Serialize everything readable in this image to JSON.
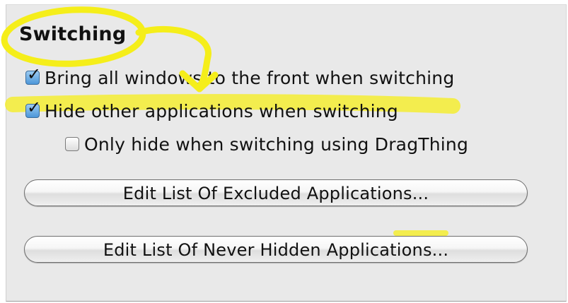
{
  "section": {
    "title": "Switching"
  },
  "options": [
    {
      "label": "Bring all windows to the front when switching",
      "checked": true
    },
    {
      "label": "Hide other applications when switching",
      "checked": true
    },
    {
      "label": "Only hide when switching using DragThing",
      "checked": false
    }
  ],
  "buttons": {
    "excluded_label": "Edit List Of Excluded Applications...",
    "never_hidden_label": "Edit List Of Never Hidden Applications..."
  },
  "colors": {
    "panel_background": "#e9e9e9",
    "checkbox_checked": "#4d97d9",
    "annotation_highlight": "#f5ee1a"
  }
}
